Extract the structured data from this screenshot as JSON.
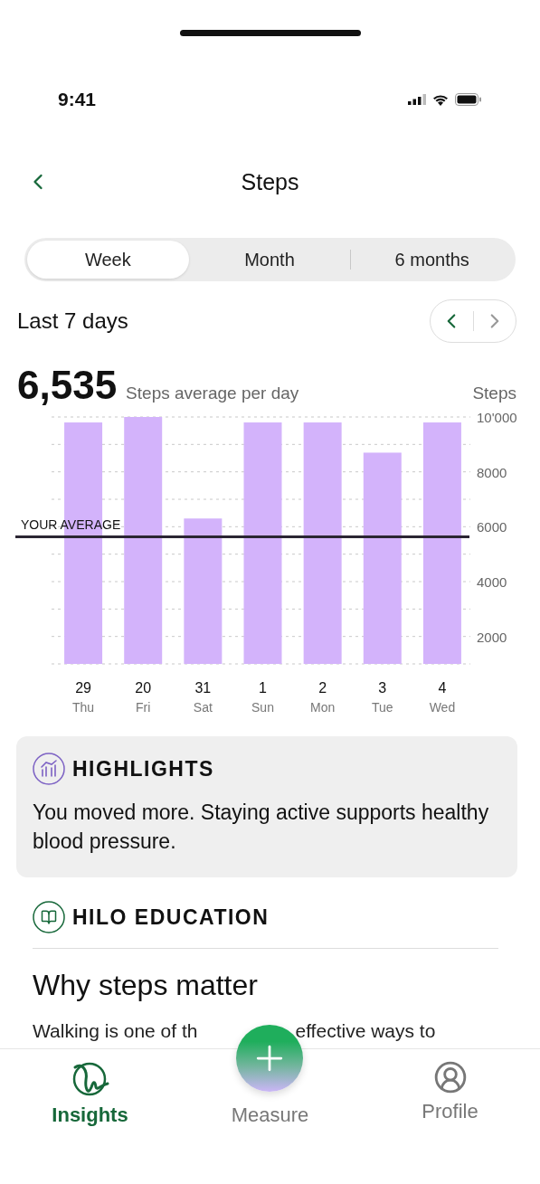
{
  "status_bar": {
    "time": "9:41"
  },
  "header": {
    "title": "Steps"
  },
  "range_tabs": [
    {
      "label": "Week",
      "selected": true
    },
    {
      "label": "Month",
      "selected": false
    },
    {
      "label": "6 months",
      "selected": false
    }
  ],
  "period": {
    "label": "Last 7 days",
    "prev_disabled": false,
    "next_disabled": true
  },
  "summary": {
    "value": "6,535",
    "caption": "Steps average per day"
  },
  "chart": {
    "weekdays": [
      "Thu",
      "Fri",
      "Sat",
      "Sun",
      "Mon",
      "Tue",
      "Wed"
    ],
    "chart_data": {
      "type": "bar",
      "grid": true,
      "categories": [
        "29",
        "20",
        "31",
        "1",
        "2",
        "3",
        "4"
      ],
      "series": [
        {
          "color": "#d3b3fb",
          "values": [
            9800,
            10000,
            6300,
            9800,
            9800,
            8700,
            9800
          ]
        }
      ],
      "ylim": [
        1000,
        10000
      ],
      "yticks": [
        {
          "value": 10000,
          "label": "10'000"
        },
        {
          "value": 8000,
          "label": "8000"
        },
        {
          "value": 6000,
          "label": "6000"
        },
        {
          "value": 4000,
          "label": "4000"
        },
        {
          "value": 2000,
          "label": "2000"
        }
      ],
      "ylabel": "Steps"
    },
    "average_label": "YOUR AVERAGE"
  },
  "highlights": {
    "title": "HIGHLIGHTS",
    "text": "You moved more. Staying active supports healthy blood pressure."
  },
  "education": {
    "title": "HILO EDUCATION",
    "article_title": "Why steps matter",
    "article_text": [
      "Walking is one of th",
      "effective ways to"
    ]
  },
  "nav": [
    {
      "label": "Insights",
      "selected": true
    },
    {
      "label": "Measure",
      "selected": false
    },
    {
      "label": "Profile",
      "selected": false
    }
  ]
}
